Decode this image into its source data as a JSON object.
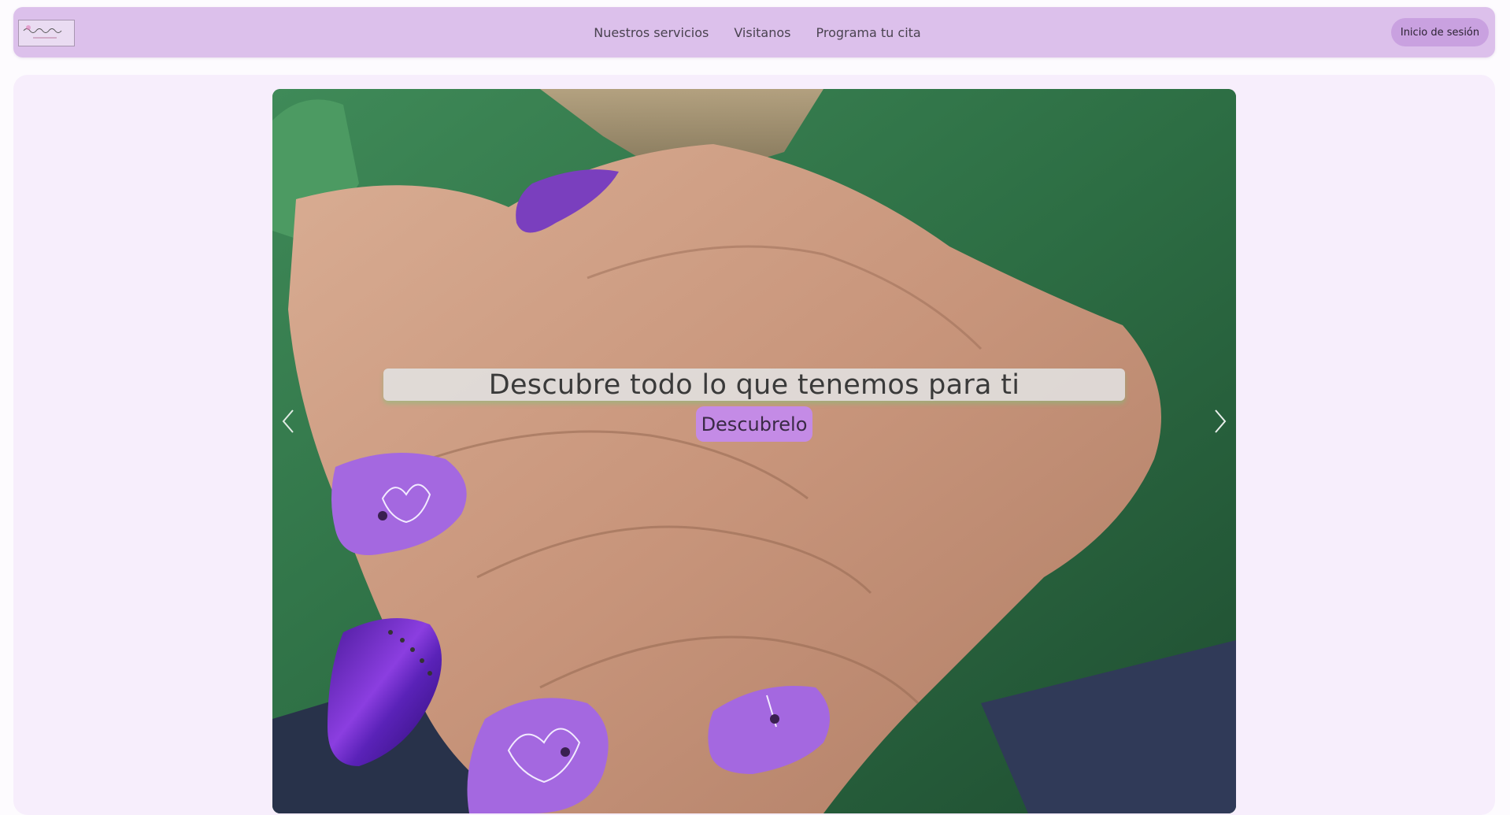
{
  "navbar": {
    "logo_alt": "logo",
    "links": [
      {
        "label": "Nuestros servicios"
      },
      {
        "label": "Visitanos"
      },
      {
        "label": "Programa tu cita"
      }
    ],
    "login_label": "Inicio de sesión"
  },
  "hero": {
    "caption": "Descubre todo lo que tenemos para ti",
    "cta_label": "Descubrelo",
    "prev_icon": "chevron-left-icon",
    "next_icon": "chevron-right-icon"
  },
  "colors": {
    "navbar_bg": "#dcc0eb",
    "login_bg": "#c9a1e0",
    "cta_bg": "#c48be6",
    "panel_bg": "#f7eefc",
    "nail_purple": "#a468e0"
  }
}
